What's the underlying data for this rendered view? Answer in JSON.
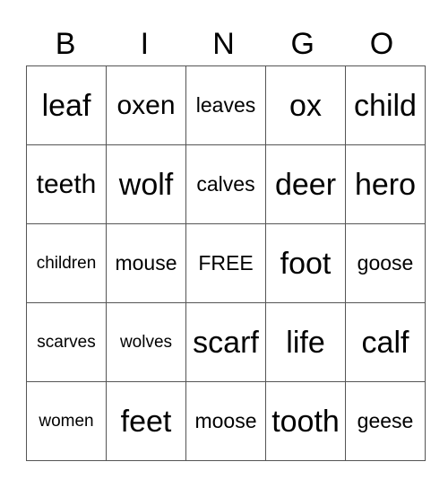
{
  "header": [
    "B",
    "I",
    "N",
    "G",
    "O"
  ],
  "rows": [
    [
      {
        "text": "leaf",
        "size": "s1"
      },
      {
        "text": "oxen",
        "size": "s2"
      },
      {
        "text": "leaves",
        "size": "s3"
      },
      {
        "text": "ox",
        "size": "s1"
      },
      {
        "text": "child",
        "size": "s1"
      }
    ],
    [
      {
        "text": "teeth",
        "size": "s2"
      },
      {
        "text": "wolf",
        "size": "s1"
      },
      {
        "text": "calves",
        "size": "s3"
      },
      {
        "text": "deer",
        "size": "s1"
      },
      {
        "text": "hero",
        "size": "s1"
      }
    ],
    [
      {
        "text": "children",
        "size": "s4"
      },
      {
        "text": "mouse",
        "size": "s3"
      },
      {
        "text": "FREE",
        "size": "s3"
      },
      {
        "text": "foot",
        "size": "s1"
      },
      {
        "text": "goose",
        "size": "s3"
      }
    ],
    [
      {
        "text": "scarves",
        "size": "s4"
      },
      {
        "text": "wolves",
        "size": "s4"
      },
      {
        "text": "scarf",
        "size": "s1"
      },
      {
        "text": "life",
        "size": "s1"
      },
      {
        "text": "calf",
        "size": "s1"
      }
    ],
    [
      {
        "text": "women",
        "size": "s4"
      },
      {
        "text": "feet",
        "size": "s1"
      },
      {
        "text": "moose",
        "size": "s3"
      },
      {
        "text": "tooth",
        "size": "s1"
      },
      {
        "text": "geese",
        "size": "s3"
      }
    ]
  ]
}
